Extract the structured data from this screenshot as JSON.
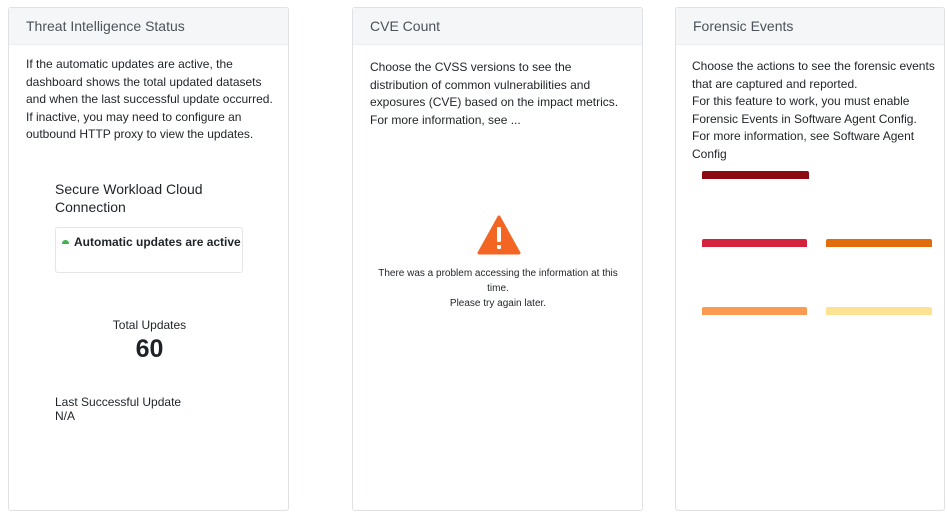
{
  "threat": {
    "title": "Threat Intelligence Status",
    "description": "If the automatic updates are active, the dashboard shows the total updated datasets and when the last successful update occurred. If inactive, you may need to configure an outbound HTTP proxy to view the updates.",
    "connection_title": "Secure Workload Cloud Connection",
    "status_text": "Automatic updates are active",
    "status_color": "#3fb34f",
    "total_label": "Total Updates",
    "total_value": "60",
    "last_label": "Last Successful Update",
    "last_value": "N/A"
  },
  "cve": {
    "title": "CVE Count",
    "description_1": "Choose the CVSS versions to see the distribution of common vulnerabilities and exposures (CVE) based on the impact metrics.",
    "description_2": "For more information, see ...",
    "warning_icon": "warning-triangle-icon",
    "warning_color": "#f26522",
    "error_line_1": "There was a problem accessing the information at this time.",
    "error_line_2": "Please try again later."
  },
  "forensic": {
    "title": "Forensic Events",
    "description_1": "Choose the actions to see the forensic events that are captured and reported.",
    "description_2": "For this feature to work, you must enable Forensic Events in Software Agent Config.",
    "description_3": "For more information, see Software Agent Config",
    "bar_colors": [
      "#8b0a14",
      "#d4213d",
      "#e06c0c",
      "#fb9b51",
      "#fce292"
    ]
  }
}
